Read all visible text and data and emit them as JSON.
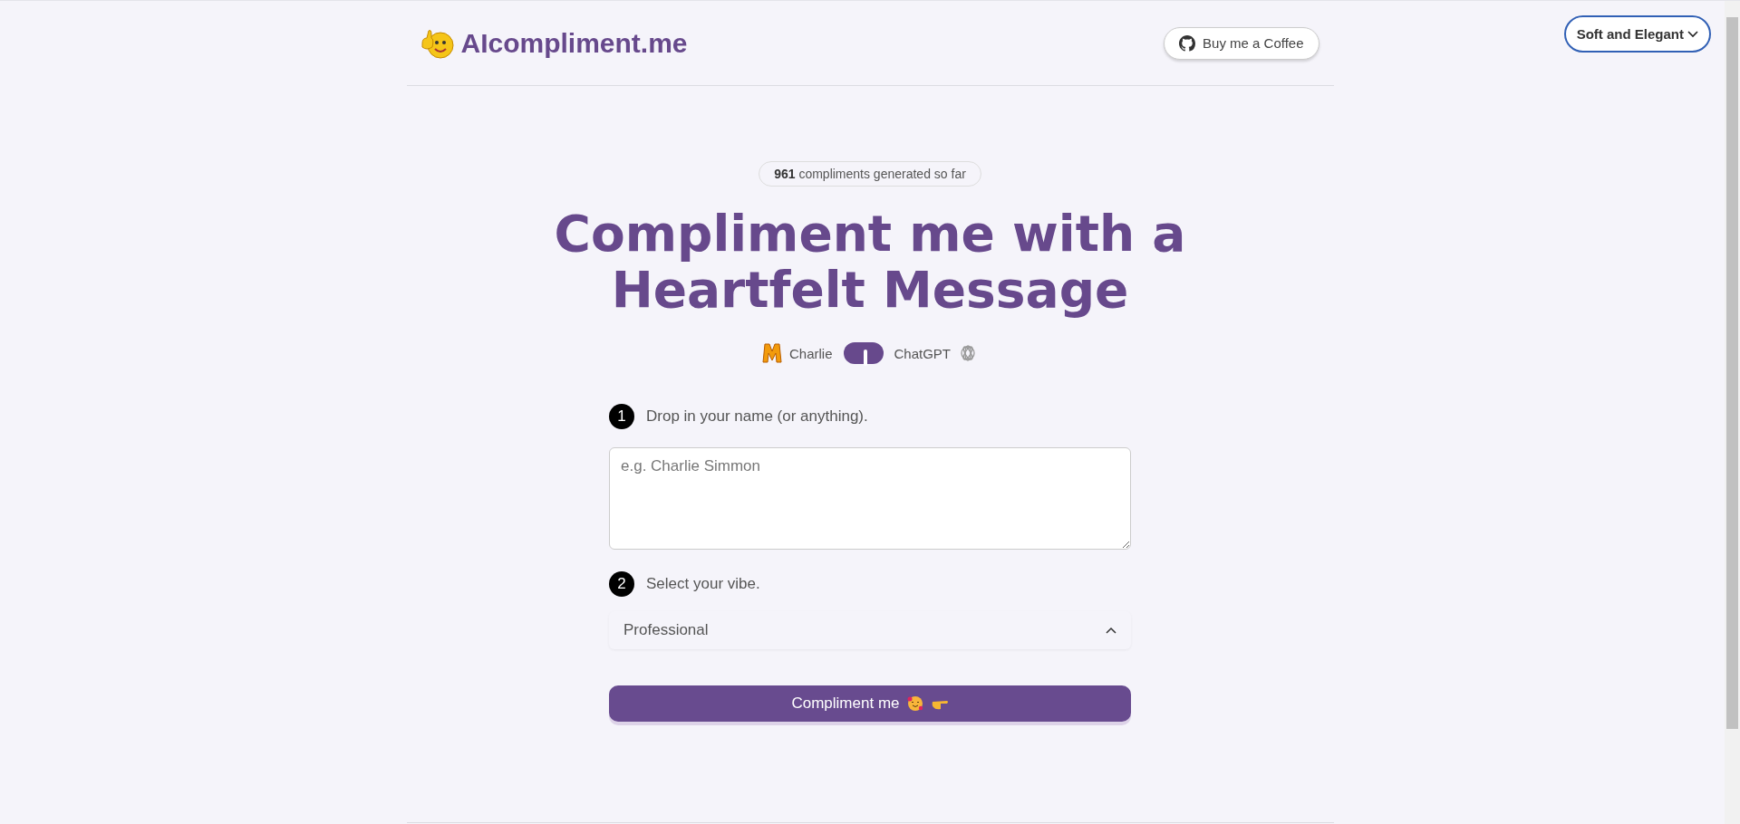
{
  "header": {
    "logo": "AIcompliment.me",
    "coffee_button": "Buy me a Coffee"
  },
  "theme_select": {
    "value": "Soft and Elegant",
    "expanded": false
  },
  "counter": {
    "count": "961",
    "text": "compliments generated so far"
  },
  "headline": [
    "Compliment me with a",
    "Heartfelt Message"
  ],
  "model_toggle": {
    "left": "Charlie",
    "right": "ChatGPT",
    "on": true
  },
  "steps": [
    {
      "number": "1",
      "label": "Drop in your name (or anything)."
    },
    {
      "number": "2",
      "label": "Select your vibe."
    }
  ],
  "name_field": {
    "placeholder": "e.g. Charlie Simmon"
  },
  "vibe_select": {
    "value": "Professional",
    "expanded": true
  },
  "submit_button": "Compliment me"
}
